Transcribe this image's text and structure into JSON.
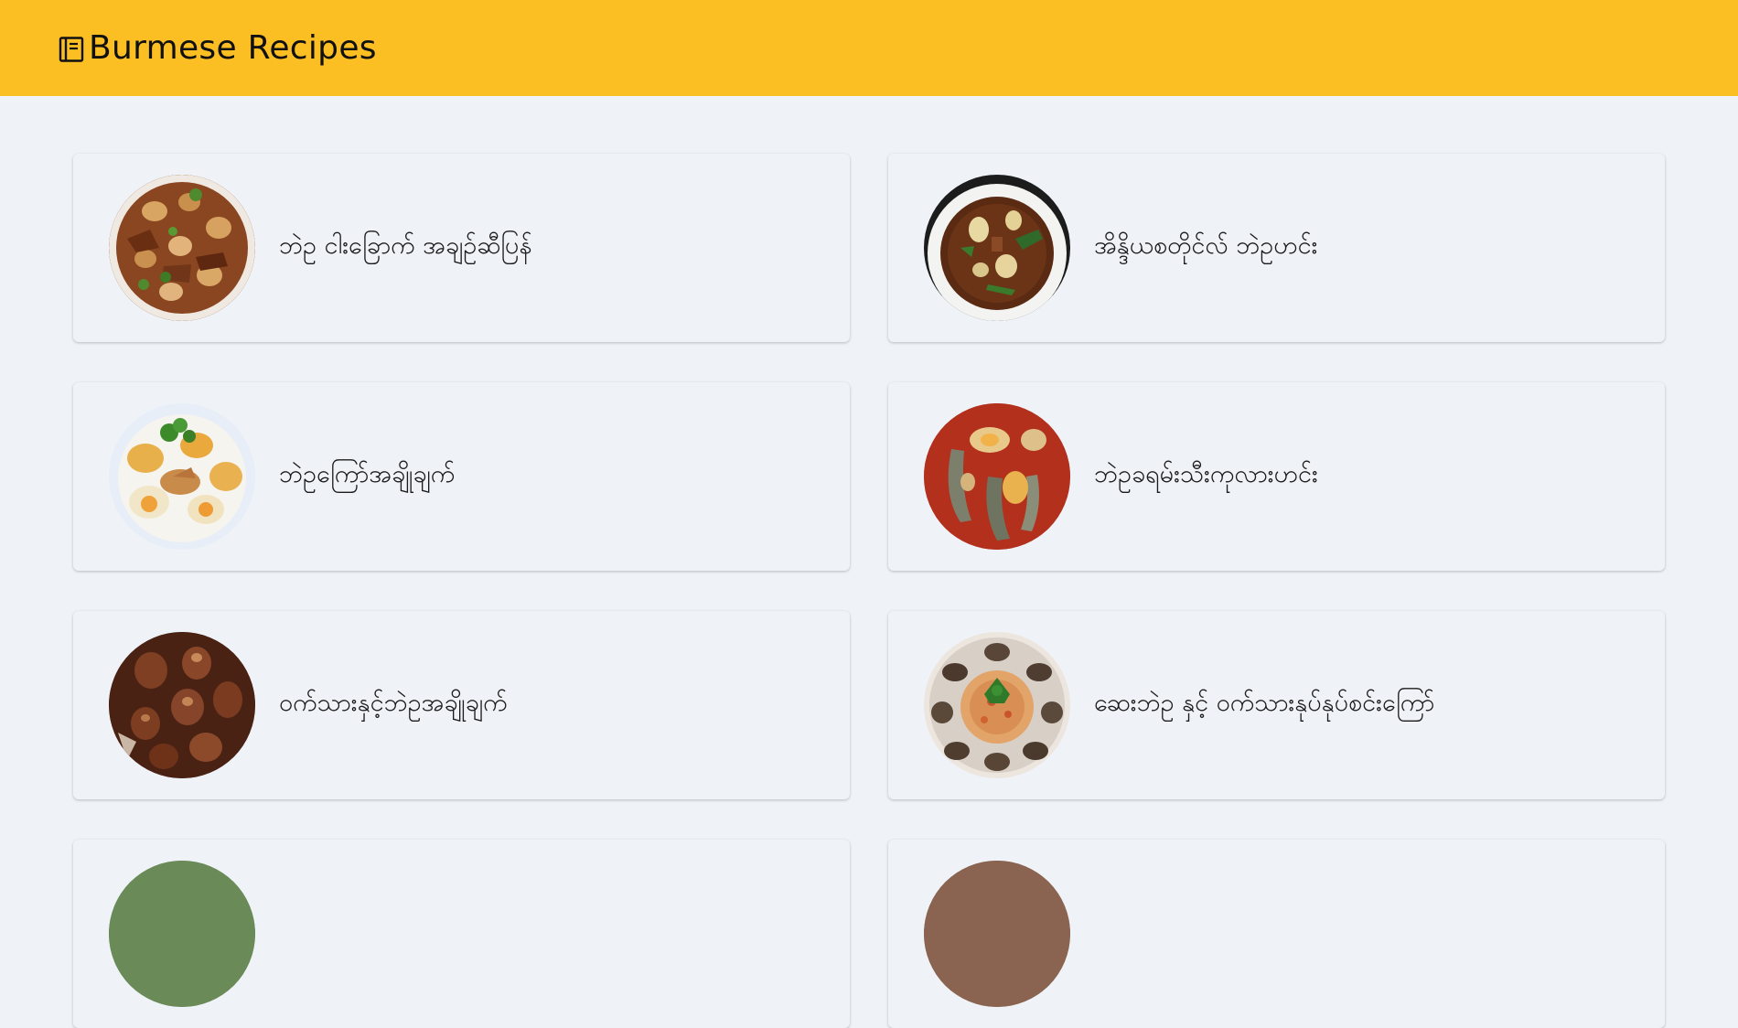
{
  "header": {
    "title": "Burmese Recipes",
    "logo_icon": "book-icon",
    "background": "#fbbf24"
  },
  "recipes": [
    {
      "name": "ဘဲဥ ငါးခြောက် အချဉ်ဆီပြန်",
      "image": "braised-egg-pork-photo"
    },
    {
      "name": "အိန္ဒိယစတိုင်လ် ဘဲဥဟင်း",
      "image": "egg-curry-bowl-photo"
    },
    {
      "name": "ဘဲဥကြော်အချိုချက်",
      "image": "fried-egg-salad-photo"
    },
    {
      "name": "ဘဲဥခရမ်းသီးကုလားဟင်း",
      "image": "eggplant-egg-curry-photo"
    },
    {
      "name": "ဝက်သားနှင့်ဘဲဥအချိုချက်",
      "image": "sweet-pork-egg-photo"
    },
    {
      "name": "ဆေးဘဲဥ နှင့် ဝက်သားနုပ်နုပ်စင်းကြော်",
      "image": "century-egg-pork-photo"
    },
    {
      "name": "",
      "image": "recipe-photo"
    },
    {
      "name": "",
      "image": "recipe-photo"
    }
  ]
}
